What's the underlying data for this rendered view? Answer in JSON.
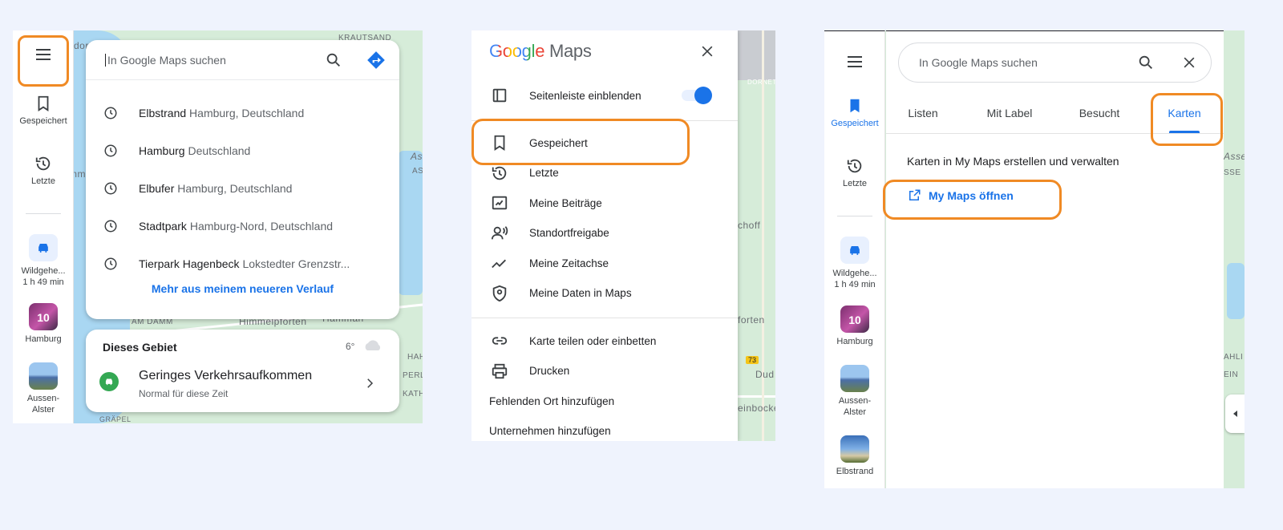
{
  "colors": {
    "accent": "#1a73e8",
    "highlight": "#f08a24",
    "background": "#eff3fd",
    "traffic_green": "#34a853"
  },
  "panel1": {
    "map_labels": [
      "KRAUTSAND",
      "dorf",
      "Ass",
      "ASS",
      "AM DAMM",
      "Himmelpforten",
      "Hammah",
      "HAH",
      "PERLE",
      "KATHE",
      "GRÄPEL",
      "mm"
    ],
    "rail": {
      "menu_icon": "menu-icon",
      "saved_label": "Gespeichert",
      "recent_label": "Letzte",
      "items": [
        {
          "title": "Wildgehe...",
          "subtitle": "1 h 49 min",
          "icon": "car-icon"
        },
        {
          "title": "Hamburg",
          "badge": "10"
        },
        {
          "title": "Aussen-Alster"
        }
      ]
    },
    "search": {
      "placeholder": "In Google Maps suchen"
    },
    "history": [
      {
        "main": "Elbstrand",
        "sub": "Hamburg, Deutschland"
      },
      {
        "main": "Hamburg",
        "sub": "Deutschland"
      },
      {
        "main": "Elbufer",
        "sub": "Hamburg, Deutschland"
      },
      {
        "main": "Stadtpark",
        "sub": "Hamburg-Nord, Deutschland"
      },
      {
        "main": "Tierpark Hagenbeck",
        "sub": "Lokstedter Grenzstr..."
      }
    ],
    "more_history": "Mehr aus meinem neueren Verlauf",
    "area": {
      "title": "Dieses Gebiet",
      "temp": "6°",
      "traffic_title": "Geringes Verkehrsaufkommen",
      "traffic_sub": "Normal für diese Zeit"
    }
  },
  "panel2": {
    "logo_google": "Google",
    "logo_maps": "Maps",
    "sidebar_toggle": {
      "label": "Seitenleiste einblenden",
      "on": true
    },
    "items": [
      {
        "label": "Gespeichert",
        "icon": "bookmark-icon"
      },
      {
        "label": "Letzte",
        "icon": "history-icon"
      },
      {
        "label": "Meine Beiträge",
        "icon": "contributions-icon"
      },
      {
        "label": "Standortfreigabe",
        "icon": "location-sharing-icon"
      },
      {
        "label": "Meine Zeitachse",
        "icon": "timeline-icon"
      },
      {
        "label": "Meine Daten in Maps",
        "icon": "shield-icon"
      }
    ],
    "items2": [
      {
        "label": "Karte teilen oder einbetten",
        "icon": "link-icon"
      },
      {
        "label": "Drucken",
        "icon": "print-icon"
      }
    ],
    "links": [
      "Fehlenden Ort hinzufügen",
      "Unternehmen hinzufügen"
    ],
    "map_labels": [
      "choff",
      "forten",
      "73",
      "Dud",
      "einbocke",
      "DORNET"
    ]
  },
  "panel3": {
    "rail": {
      "saved_label": "Gespeichert",
      "recent_label": "Letzte",
      "items": [
        {
          "title": "Wildgehe...",
          "subtitle": "1 h 49 min"
        },
        {
          "title": "Hamburg",
          "badge": "10"
        },
        {
          "title": "Aussen-Alster"
        },
        {
          "title": "Elbstrand"
        }
      ]
    },
    "search": {
      "placeholder": "In Google Maps suchen"
    },
    "tabs": [
      "Listen",
      "Mit Label",
      "Besucht",
      "Karten"
    ],
    "active_tab": "Karten",
    "description": "Karten in My Maps erstellen und verwalten",
    "open_link": "My Maps öffnen",
    "map_labels": [
      "Asse",
      "SSE",
      "AHLI",
      "EIN"
    ]
  }
}
